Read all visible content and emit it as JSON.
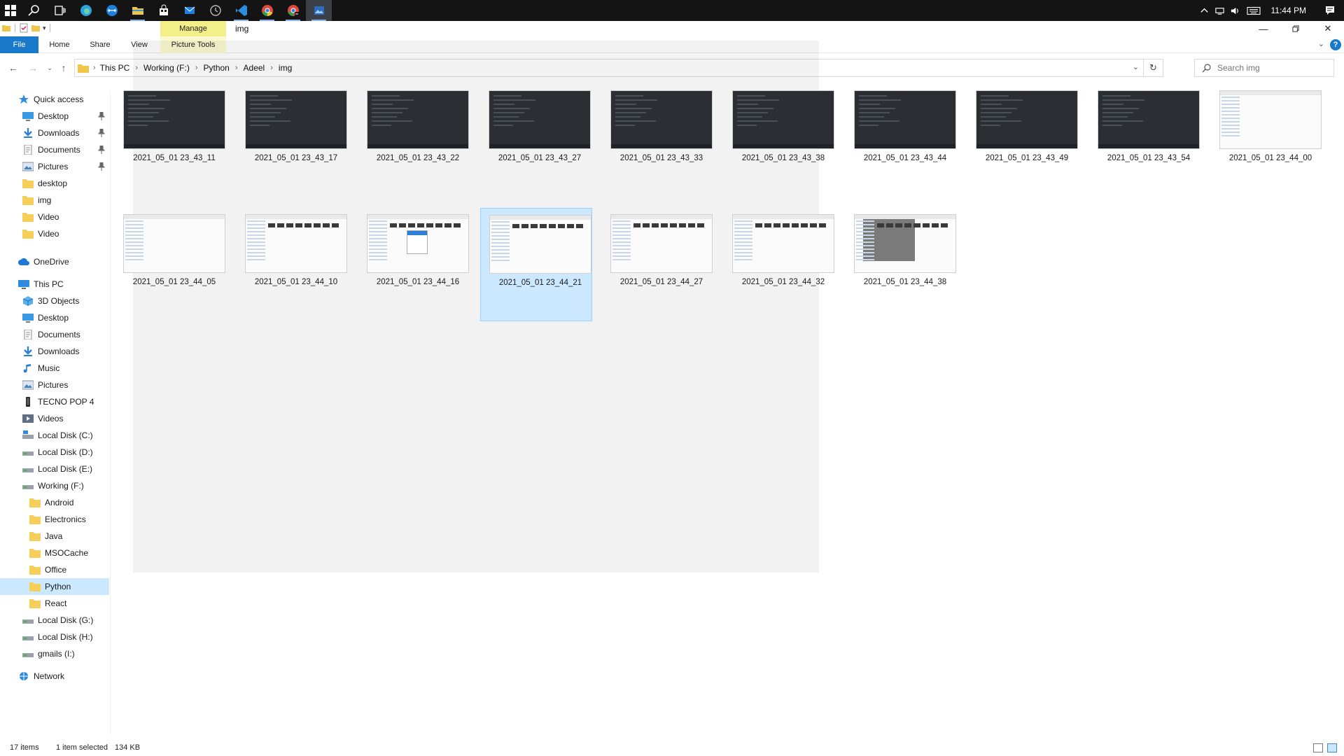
{
  "taskbar": {
    "apps": [
      {
        "name": "windows-start-icon"
      },
      {
        "name": "search-icon"
      },
      {
        "name": "task-view-icon"
      },
      {
        "name": "edge-icon"
      },
      {
        "name": "teamviewer-icon"
      },
      {
        "name": "file-explorer-icon"
      },
      {
        "name": "store-icon"
      },
      {
        "name": "mail-icon"
      },
      {
        "name": "clock-app-icon"
      },
      {
        "name": "vscode-icon"
      },
      {
        "name": "chrome-icon"
      },
      {
        "name": "chrome-canary-icon"
      },
      {
        "name": "photos-icon"
      }
    ],
    "clock": "11:44 PM"
  },
  "titlebar": {
    "manage_label": "Manage",
    "title": "img"
  },
  "ribbon": {
    "file": "File",
    "home": "Home",
    "share": "Share",
    "view": "View",
    "picture_tools": "Picture Tools"
  },
  "address": {
    "crumbs": [
      "This PC",
      "Working (F:)",
      "Python",
      "Adeel",
      "img"
    ],
    "search_placeholder": "Search img"
  },
  "nav": {
    "quick_access": "Quick access",
    "quick_items": [
      "Desktop",
      "Downloads",
      "Documents",
      "Pictures",
      "desktop",
      "img",
      "Video",
      "Video"
    ],
    "onedrive": "OneDrive",
    "this_pc": "This PC",
    "pc_items": [
      "3D Objects",
      "Desktop",
      "Documents",
      "Downloads",
      "Music",
      "Pictures",
      "TECNO POP 4",
      "Videos",
      "Local Disk (C:)",
      "Local Disk (D:)",
      "Local Disk (E:)",
      "Working (F:)"
    ],
    "f_items": [
      "Android",
      "Electronics",
      "Java",
      "MSOCache",
      "Office",
      "Python",
      "React"
    ],
    "more_drives": [
      "Local Disk (G:)",
      "Local Disk (H:)",
      "gmails (I:)"
    ],
    "network": "Network"
  },
  "files": [
    {
      "name": "2021_05_01 23_43_11",
      "style": "dark"
    },
    {
      "name": "2021_05_01 23_43_17",
      "style": "dark"
    },
    {
      "name": "2021_05_01 23_43_22",
      "style": "dark"
    },
    {
      "name": "2021_05_01 23_43_27",
      "style": "dark"
    },
    {
      "name": "2021_05_01 23_43_33",
      "style": "dark"
    },
    {
      "name": "2021_05_01 23_43_38",
      "style": "dark"
    },
    {
      "name": "2021_05_01 23_43_44",
      "style": "dark"
    },
    {
      "name": "2021_05_01 23_43_49",
      "style": "dark"
    },
    {
      "name": "2021_05_01 23_43_54",
      "style": "dark"
    },
    {
      "name": "2021_05_01 23_44_00",
      "style": "light"
    },
    {
      "name": "2021_05_01 23_44_05",
      "style": "light"
    },
    {
      "name": "2021_05_01 23_44_10",
      "style": "light"
    },
    {
      "name": "2021_05_01 23_44_16",
      "style": "light"
    },
    {
      "name": "2021_05_01 23_44_21",
      "style": "light",
      "selected": true
    },
    {
      "name": "2021_05_01 23_44_27",
      "style": "light"
    },
    {
      "name": "2021_05_01 23_44_32",
      "style": "light"
    },
    {
      "name": "2021_05_01 23_44_38",
      "style": "light"
    }
  ],
  "status": {
    "items": "17 items",
    "selected": "1 item selected",
    "size": "134 KB"
  },
  "colors": {
    "accent": "#1979ca",
    "selection": "#cce8ff",
    "manage_highlight": "#f3f08a",
    "taskbar": "#141414"
  }
}
